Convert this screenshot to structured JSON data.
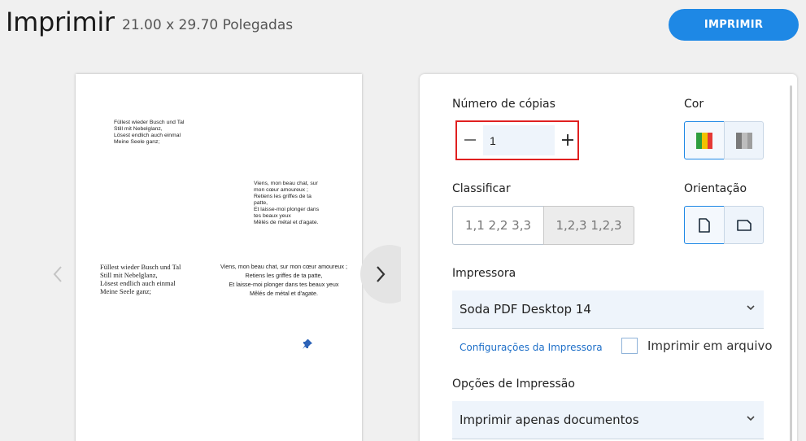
{
  "header": {
    "title": "Imprimir",
    "subtitle": "21.00 x 29.70 Polegadas",
    "print_button": "IMPRIMIR"
  },
  "preview": {
    "block1": "Füllest wieder Busch und Tal\nStill mit Nebelglanz,\nLösest endlich auch einmal\nMeine Seele ganz;",
    "block2": "Viens, mon beau chat, sur\nmon cœur amoureux ;\nRetiens les griffes de ta\npatte,\nEt laisse-moi plonger dans\ntes beaux yeux\nMêlés de métal et d'agate.",
    "block3": "Füllest wieder Busch und Tal\nStill mit Nebelglanz,\nLösest endlich auch einmal\nMeine Seele ganz;",
    "block4": "Viens, mon beau chat, sur mon cœur amoureux ;\nRetiens les griffes de ta patte,\nEt laisse-moi plonger dans tes beaux yeux\nMêlés de métal et d'agate."
  },
  "settings": {
    "copies_label": "Número de cópias",
    "copies_value": "1",
    "color_label": "Cor",
    "collate_label": "Classificar",
    "collate_options": [
      "1,1 2,2 3,3",
      "1,2,3 1,2,3"
    ],
    "orientation_label": "Orientação",
    "printer_label": "Impressora",
    "printer_value": "Soda PDF Desktop 14",
    "printer_settings_link": "Configurações da Impressora",
    "print_to_file_label": "Imprimir em arquivo",
    "print_options_label": "Opções de Impressão",
    "print_options_value": "Imprimir apenas documentos"
  },
  "colors": {
    "accent": "#1e88e5",
    "highlight_border": "#e02020"
  }
}
